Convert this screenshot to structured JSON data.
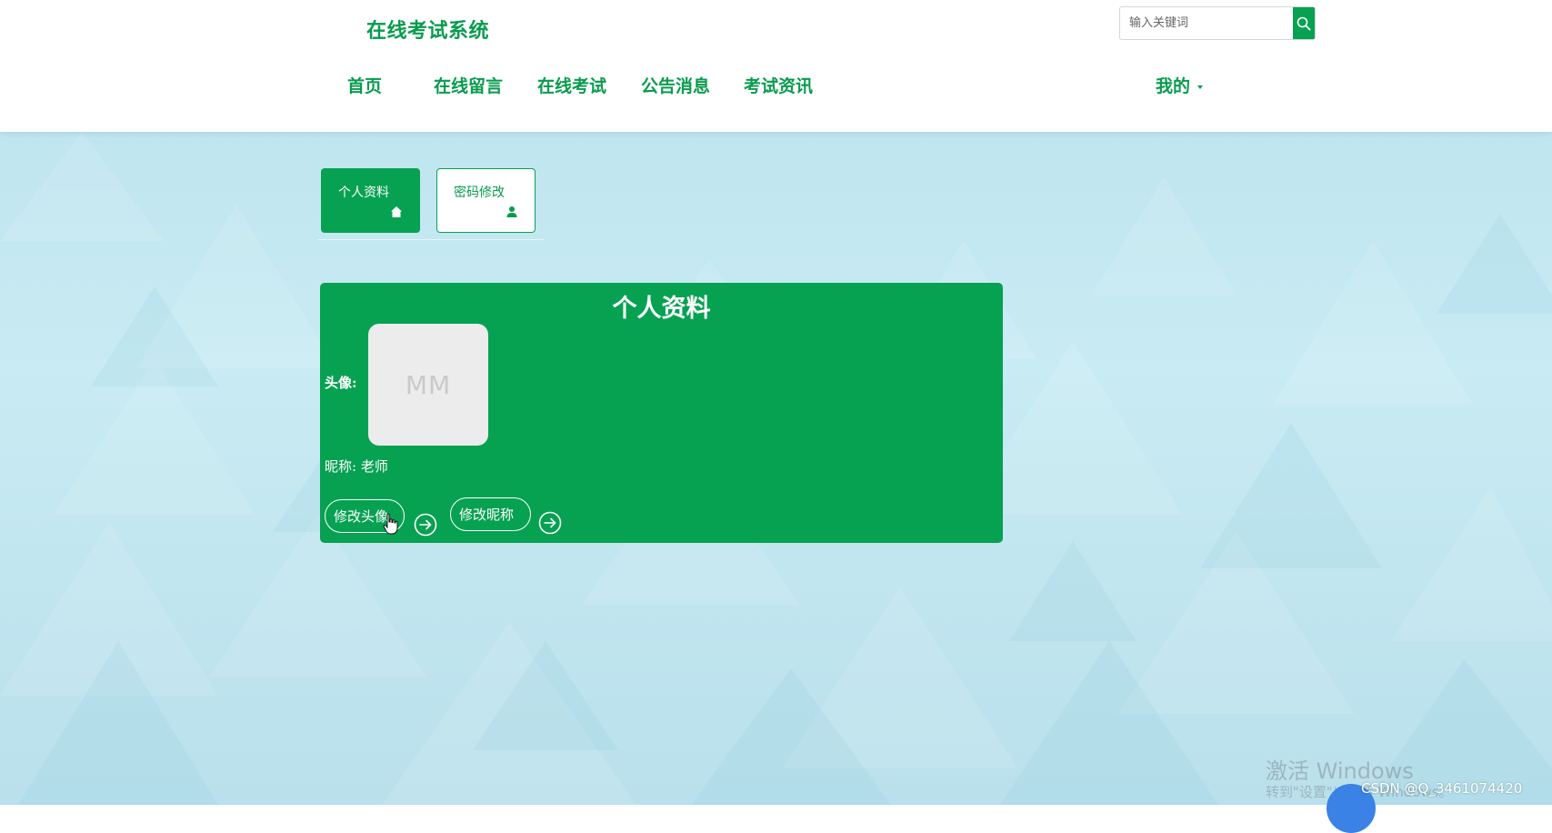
{
  "header": {
    "brand": "在线考试系统",
    "search": {
      "placeholder": "输入关键词",
      "button_icon": "search-icon"
    },
    "nav": {
      "home": "首页",
      "message": "在线留言",
      "exam": "在线考试",
      "notice": "公告消息",
      "news": "考试资讯",
      "mine": "我的"
    }
  },
  "tabs": {
    "profile": {
      "label": "个人资料",
      "icon": "home-icon"
    },
    "password": {
      "label": "密码修改",
      "icon": "user-icon"
    }
  },
  "panel": {
    "title": "个人资料",
    "avatar_label": "头像:",
    "avatar_text": "MM",
    "nickname": "昵称: 老师",
    "change_avatar_label": "修改头像",
    "change_nickname_label": "修改昵称"
  },
  "watermarks": {
    "windows_title": "激活 Windows",
    "windows_sub": "转到\"设置\"以激活 Windows。",
    "csdn": "CSDN @Q_3461074420"
  },
  "colors": {
    "accent": "#07a152",
    "brand_text": "#089b4e",
    "background": "#c4e7f1"
  }
}
